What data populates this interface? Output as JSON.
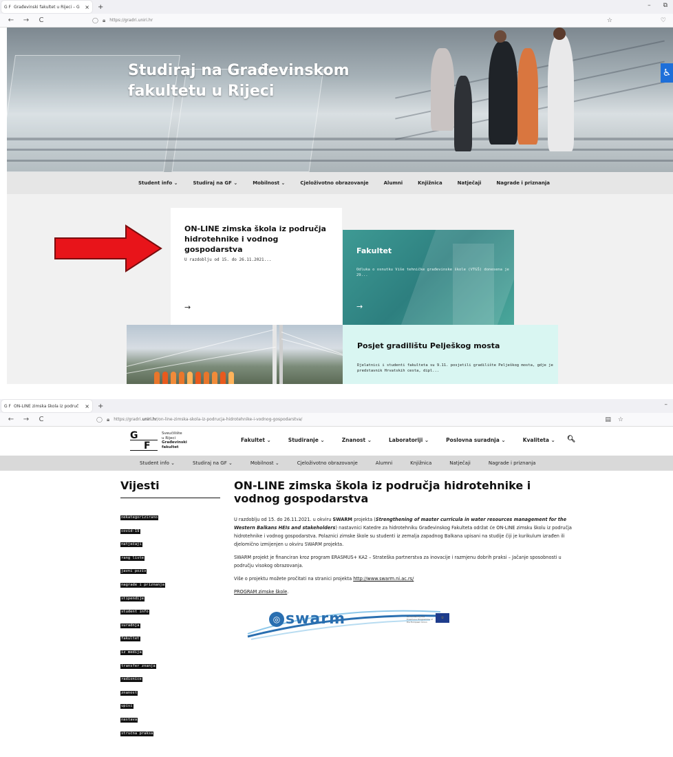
{
  "shot1": {
    "tab_title": "Građevinski fakultet u Rijeci – G",
    "tab_favicon": "G F",
    "url": "https://gradri.uniri.hr",
    "hero_title_line1": "Studiraj na Građevinskom",
    "hero_title_line2": "fakultetu u Rijeci",
    "nav": [
      "Student info ⌄",
      "Studiraj na GF ⌄",
      "Mobilnost ⌄",
      "Cjeloživotno obrazovanje",
      "Alumni",
      "Knjižnica",
      "Natječaji",
      "Nagrade i priznanja"
    ],
    "card_white": {
      "title": "ON-LINE zimska škola iz područja hidrotehnike i vodnog gospodarstva",
      "excerpt": "U razdoblju od 15. do 26.11.2021...",
      "arrow": "→"
    },
    "card_teal": {
      "title": "Fakultet",
      "excerpt": "Odluka o osnutku Više tehničke građevinske škole (VTGŠ) donesena je 29...",
      "arrow": "→"
    },
    "card_mint": {
      "title": "Posjet gradilištu Pelješkog mosta",
      "excerpt": "Djelatnici i studenti fakulteta su 9.11. posjetili gradilište Pelješkog mosta, gdje je predstavnik Hrvatskih cesta, dipl..."
    },
    "accessibility_icon": "♿",
    "annotation_color": "#e8141a"
  },
  "shot2": {
    "tab_title": "ON-LINE zimska škola iz područ",
    "tab_favicon": "G F",
    "url_prefix": "https://gradri.",
    "url_domain": "uniri.hr",
    "url_path": "/on-line-zimska-skola-iz-podrucja-hidrotehnike-i-vodnog-gospodarstva/",
    "logo": {
      "G": "G",
      "F": "F",
      "line1": "Sveučilište",
      "line2": "u Rijeci",
      "line3": "Građevinski",
      "line4": "fakultet"
    },
    "main_nav": [
      "Fakultet ⌄",
      "Studiranje ⌄",
      "Znanost ⌄",
      "Laboratoriji ⌄",
      "Poslovna suradnja ⌄",
      "Kvaliteta ⌄"
    ],
    "sub_nav": [
      "Student info ⌄",
      "Studiraj na GF ⌄",
      "Mobilnost ⌄",
      "Cjeloživotno obrazovanje",
      "Alumni",
      "Knjižnica",
      "Natječaji",
      "Nagrade i priznanja"
    ],
    "sidebar_title": "Vijesti",
    "tags": [
      "nekategorizirano",
      "covid-19",
      "natječaji",
      "rang liste",
      "javni poziv",
      "nagrade i priznanja",
      "stipendije",
      "student info",
      "suradnja",
      "fakultet",
      "iz medija",
      "transfer znanja",
      "radionice",
      "znanost",
      "upisi",
      "nastava",
      "stručna praksa"
    ],
    "article": {
      "title": "ON-LINE zimska škola iz područja hidrotehnike i vodnog gospodarstva",
      "p1_a": "U razdoblju od 15. do 26.11.2021. u okviru ",
      "p1_swarm": "SWARM",
      "p1_b": " projekta (",
      "p1_em": "Strengthening of master curricula in water resources management for the Western Balkans HEIs and stakeholders",
      "p1_c": ") nastavnici Katedre za hidrotehniku Građevinskog Fakulteta održat će ON-LINE zimsku školu iz područja hidrotehnike i vodnog gospodarstva. Polaznici zimske škole su studenti iz zemalja zapadnog Balkana upisani na studije čiji je kurikulum izrađen ili djelomično izmijenjen u okviru SWARM projekta.",
      "p2": "SWARM projekt je financiran kroz program ERASMUS+ KA2 – Strateška partnerstva za inovacije i razmjenu dobrih praksi – Jačanje sposobnosti u području visokog obrazovanja.",
      "p3_a": "Više o projektu možete pročitati na stranici projekta ",
      "p3_link": "http://www.swarm.ni.ac.rs/",
      "p4_link": "PROGRAM zimske škole",
      "p4_tail": ".",
      "logo_word": "swarm",
      "eu_text": "Co-funded by the Erasmus+ Programme of the European Union"
    }
  },
  "chrome": {
    "back": "←",
    "forward": "→",
    "reload": "C",
    "new_tab": "+",
    "close_tab": "×",
    "minimize": "–",
    "restore": "⧉",
    "star": "☆",
    "pocket": "♡",
    "reader": "▤",
    "lock": "🔒",
    "shield": "◯",
    "search": "🔍"
  }
}
